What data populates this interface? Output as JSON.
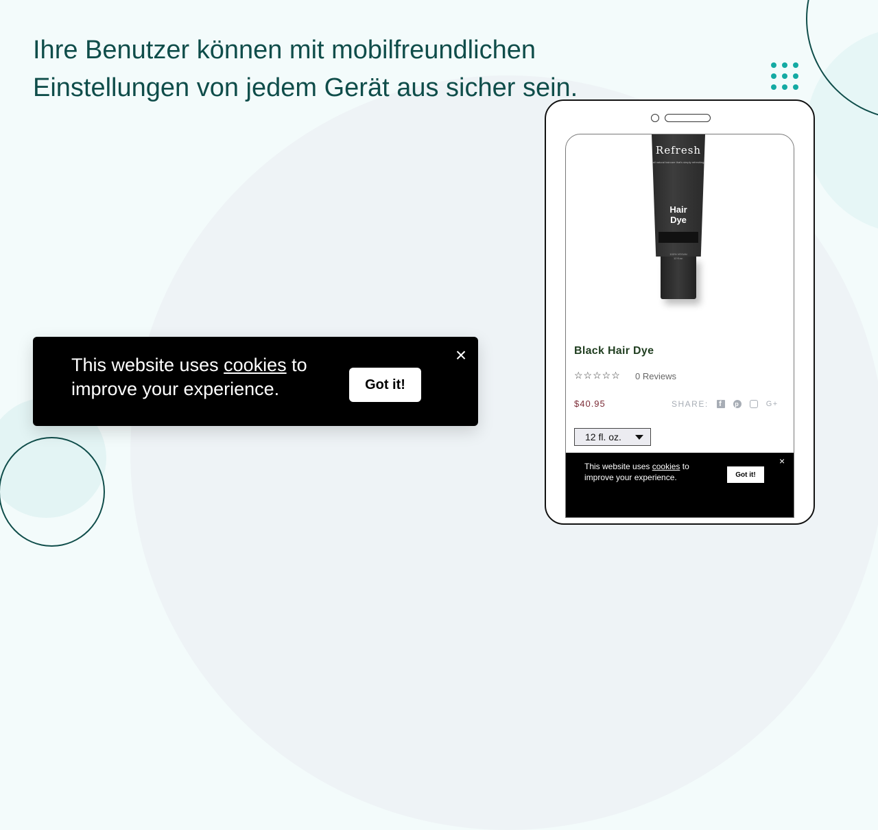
{
  "headline": "Ihre Benutzer können mit mobilfreundlichen Einstellungen von jedem Gerät aus sicher sein.",
  "cookie_banner": {
    "text_before": "This website uses ",
    "link_text": "cookies",
    "text_after": " to improve your experience.",
    "button_label": "Got it!",
    "close_icon": "×"
  },
  "phone": {
    "product_image": {
      "brand": "Refresh",
      "tagline": "all natural haircare that's simply refreshing",
      "name_line1": "Hair",
      "name_line2": "Dye",
      "label_line1": "100% VEGAN",
      "label_line2": "12 fl.oz."
    },
    "product_title": "Black Hair Dye",
    "stars": "☆☆☆☆☆",
    "rating": 0,
    "reviews_label": "0 Reviews",
    "price": "$40.95",
    "share_label": "SHARE:",
    "share_icons": [
      "facebook-icon",
      "pinterest-icon",
      "instagram-icon",
      "google-plus-icon"
    ],
    "size_select": {
      "selected": "12 fl. oz."
    },
    "cookie_banner": {
      "text_before": "This website uses ",
      "link_text": "cookies",
      "text_after": " to improve your experience.",
      "button_label": "Got it!",
      "close_icon": "×"
    }
  },
  "colors": {
    "headline": "#0f4d4a",
    "accent_dots": "#14aaa3",
    "price": "#7a2a35",
    "product_title": "#1f3d1f"
  }
}
